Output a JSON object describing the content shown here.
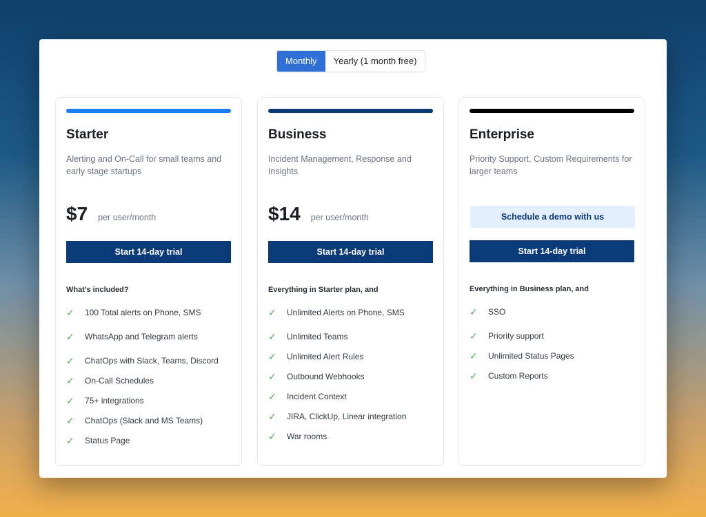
{
  "billing_toggle": {
    "monthly_label": "Monthly",
    "yearly_label": "Yearly (1 month free)",
    "active": "monthly"
  },
  "colors": {
    "toggle_active": "#2f6fd6",
    "cta_dark": "#0b3a78",
    "check": "#4caf50",
    "starter_bar": "#1a7df0",
    "business_bar": "#0b3a78",
    "enterprise_bar": "#000000"
  },
  "plans": {
    "starter": {
      "name": "Starter",
      "description": "Alerting and On-Call for small teams and early stage startups",
      "price": "$7",
      "per": "per user/month",
      "cta": "Start 14-day trial",
      "features_heading": "What's included?",
      "features": [
        "100 Total alerts on Phone, SMS",
        "WhatsApp and Telegram alerts",
        "ChatOps with Slack, Teams, Discord",
        "On-Call Schedules",
        "75+ integrations",
        "ChatOps (Slack and MS Teams)",
        "Status Page"
      ]
    },
    "business": {
      "name": "Business",
      "description": "Incident Management, Response and Insights",
      "price": "$14",
      "per": "per user/month",
      "cta": "Start 14-day trial",
      "features_heading": "Everything in Starter plan, and",
      "features": [
        "Unlimited Alerts on Phone, SMS",
        "Unlimited Teams",
        "Unlimited Alert Rules",
        "Outbound Webhooks",
        "Incident Context",
        "JIRA, ClickUp, Linear integration",
        "War rooms"
      ]
    },
    "enterprise": {
      "name": "Enterprise",
      "description": "Priority Support, Custom Requirements for larger teams",
      "demo_cta": "Schedule a demo with us",
      "cta": "Start 14-day trial",
      "features_heading": "Everything in Business plan, and",
      "features": [
        "SSO",
        "Priority support",
        "Unlimited Status Pages",
        "Custom Reports"
      ]
    }
  }
}
